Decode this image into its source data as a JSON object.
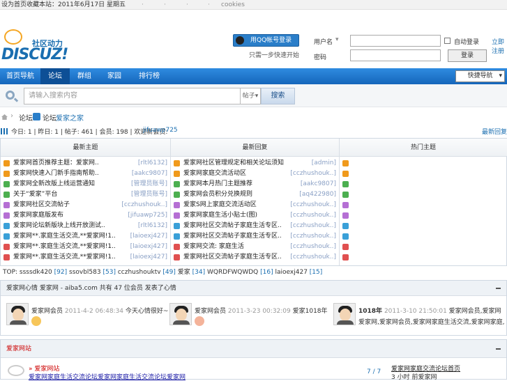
{
  "topbar": {
    "text": "设为首页收藏本站：2011年6月17日 星期五",
    "cookies": "cookies"
  },
  "header": {
    "slogan": "社区动力",
    "logo_word": "DISCUZ!",
    "qq_login": "用QQ帐号登录",
    "qq_sub": "只需一步快速开始",
    "user_label": "用户名",
    "user_dropdown": "▾",
    "pass_label": "密码",
    "auto_login": "自动登录",
    "register": "立即注册",
    "login_btn": "登录"
  },
  "nav": {
    "items": [
      "首页导航",
      "论坛",
      "群组",
      "家园",
      "排行榜"
    ],
    "quick": "快捷导航"
  },
  "search": {
    "placeholder": "请输入搜索内容",
    "type": "帖子",
    "button": "搜索"
  },
  "breadcrumb": {
    "sep": "论坛",
    "label": "论坛",
    "link": "爱家之家"
  },
  "stats": {
    "text": "今日: 1 | 昨日: 1 | 帖子: 461 | 会员: 198 | 欢迎新会员: ",
    "newest": "jifuawp725",
    "right": "最新回复"
  },
  "columns": [
    {
      "title": "最新主题",
      "rows": [
        {
          "t": "爱家网首页推荐主题：爱家网..",
          "a": "[rltl6132]",
          "c": "#f09a1c"
        },
        {
          "t": "爱家网快速入门新手指南帮助..",
          "a": "[aakc9807]",
          "c": "#f09a1c"
        },
        {
          "t": "爱家网全新改版上线运营通知",
          "a": "[管理员账号]",
          "c": "#4caf50"
        },
        {
          "t": "关于“爱家”平台",
          "a": "[管理员账号]",
          "c": "#4caf50"
        },
        {
          "t": "爱家网社区交流帖子",
          "a": "[cczhushouk..]",
          "c": "#b56fd4"
        },
        {
          "t": "爱家网家庭版发布",
          "a": "[jifuawp725]",
          "c": "#b56fd4"
        },
        {
          "t": "爱家网论坛新版块上线开放测试..",
          "a": "[rltl6132]",
          "c": "#3aa0d8"
        },
        {
          "t": "爱家网**.家庭生活交流,**爱家网!1..",
          "a": "[laioexj427]",
          "c": "#3aa0d8"
        },
        {
          "t": "爱家网**.家庭生活交流,**爱家网!1..",
          "a": "[laioexj427]",
          "c": "#e05050"
        },
        {
          "t": "爱家网**.家庭生活交流,**爱家网!1..",
          "a": "[laioexj427]",
          "c": "#e05050"
        }
      ]
    },
    {
      "title": "最新回复",
      "rows": [
        {
          "t": "爱家网社区管理规定和相关论坛须知",
          "a": "[admin]",
          "c": "#f09a1c"
        },
        {
          "t": "爱家网家庭交流活动区",
          "a": "[cczhushouk..]",
          "c": "#f09a1c"
        },
        {
          "t": "爱家网本月热门主题推荐",
          "a": "[aakc9807]",
          "c": "#4caf50"
        },
        {
          "t": "爱家网会员积分兑换规则",
          "a": "[aq422980]",
          "c": "#4caf50"
        },
        {
          "t": "爱家S网上家庭交流活动区",
          "a": "[cczhushouk..]",
          "c": "#b56fd4"
        },
        {
          "t": "爱家网家庭生活小贴士(图)",
          "a": "[cczhushouk..]",
          "c": "#b56fd4"
        },
        {
          "t": "爱家网社区交流帖子家庭生活专区..",
          "a": "[cczhushouk..]",
          "c": "#3aa0d8"
        },
        {
          "t": "爱家网社区交流帖子家庭生活专区..",
          "a": "[cczhushouk..]",
          "c": "#3aa0d8"
        },
        {
          "t": "爱家网交流: 家庭生活",
          "a": "[cczhushouk..]",
          "c": "#e05050"
        },
        {
          "t": "爱家网社区交流帖子家庭生活专区..",
          "a": "[cczhushouk..]",
          "c": "#e05050"
        }
      ]
    },
    {
      "title": "热门主题",
      "rows": [
        {
          "t": "",
          "a": "",
          "c": "#f09a1c"
        },
        {
          "t": "",
          "a": "",
          "c": "#f09a1c"
        },
        {
          "t": "",
          "a": "",
          "c": "#4caf50"
        },
        {
          "t": "",
          "a": "",
          "c": "#4caf50"
        },
        {
          "t": "",
          "a": "",
          "c": "#b56fd4"
        },
        {
          "t": "",
          "a": "",
          "c": "#b56fd4"
        },
        {
          "t": "",
          "a": "",
          "c": "#3aa0d8"
        },
        {
          "t": "",
          "a": "",
          "c": "#3aa0d8"
        },
        {
          "t": "",
          "a": "",
          "c": "#e05050"
        },
        {
          "t": "",
          "a": "",
          "c": "#e05050"
        }
      ]
    }
  ],
  "top": {
    "prefix": "TOP: ",
    "users": [
      {
        "name": "ssssdk420",
        "n": "[92]"
      },
      {
        "name": "ssovbl583",
        "n": "[53]"
      },
      {
        "name": "cczhushouktv",
        "n": "[49]"
      },
      {
        "name": "爱家",
        "n": "[34]"
      },
      {
        "name": "WQRDFWQWDQ",
        "n": "[16]"
      },
      {
        "name": "laioexj427",
        "n": "[15]"
      }
    ]
  },
  "panel": {
    "title": "爱家网心情 爱家网 - aiba5.com 共有 47 位会员 发表了心情",
    "feeds": [
      {
        "name": "爱家网会员",
        "time": "2011-4-2 06:48:34",
        "text": "今天心情很好~"
      },
      {
        "name": "爱家网会员",
        "time": "2011-3-23 00:32:09",
        "text": "爱家1018年"
      },
      {
        "name": "1018年",
        "time": "2011-3-10 21:50:01",
        "text": "爱家网会员,爱家网"
      },
      {
        "name": "",
        "time": "",
        "text": "爱家网,爱家网会员,爱家网家庭生活交流,爱家网家庭,爱家网."
      }
    ]
  },
  "panel2": {
    "title": "爱家网站",
    "link_head": "» 爱家网站",
    "link": "爱家网家庭生活交流论坛爱家网家庭生活交流论坛爱家网",
    "pages": "7 / 7",
    "right1": "爱家网家庭交流论坛首页",
    "right2": "3 小时 前爱家网"
  }
}
